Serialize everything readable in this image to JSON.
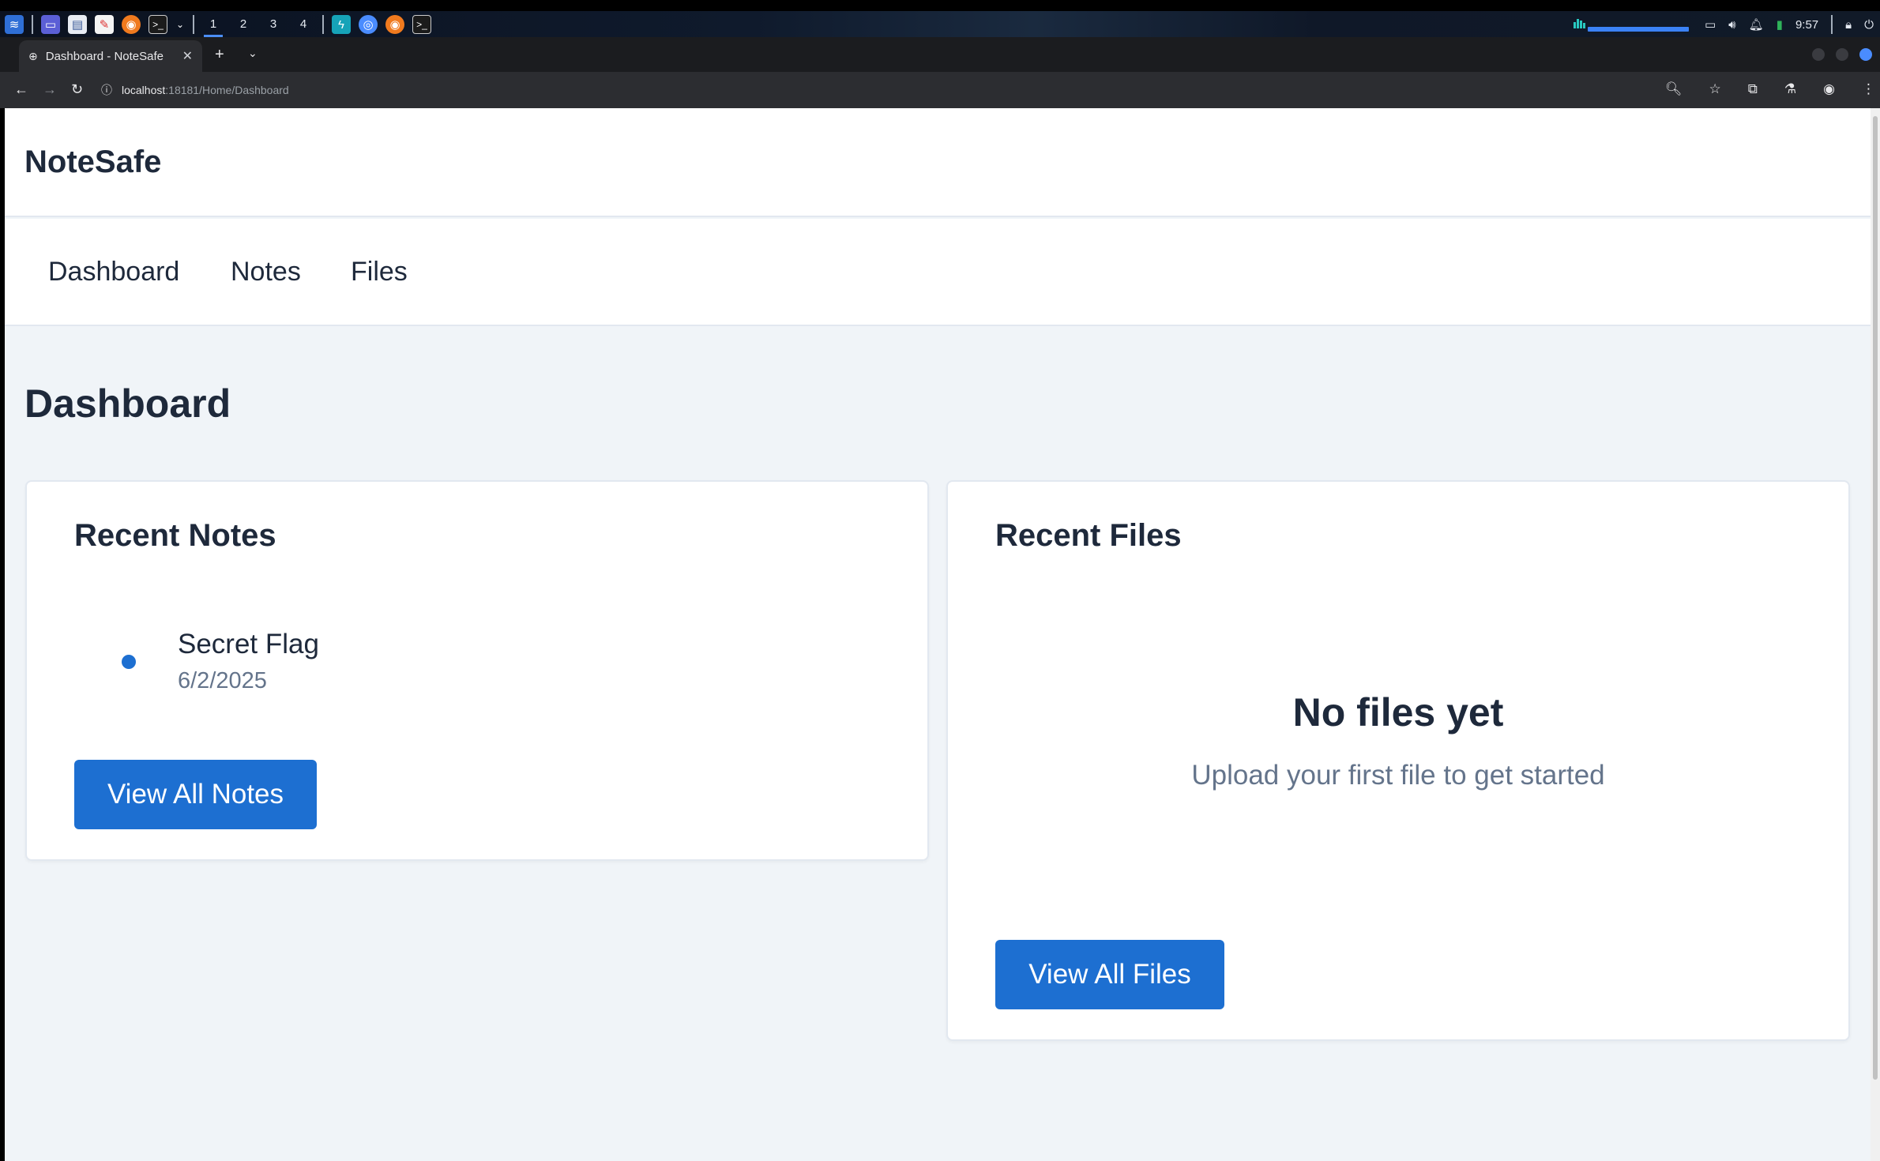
{
  "taskbar": {
    "workspaces": [
      "1",
      "2",
      "3",
      "4"
    ],
    "clock": "9:57"
  },
  "browser": {
    "tab_title": "Dashboard - NoteSafe",
    "tab_close": "✕",
    "new_tab": "+",
    "tab_list": "⌄",
    "url_host": "localhost",
    "url_path": ":18181/Home/Dashboard"
  },
  "app": {
    "brand": "NoteSafe",
    "nav": [
      "Dashboard",
      "Notes",
      "Files"
    ]
  },
  "page": {
    "title": "Dashboard"
  },
  "recent_notes": {
    "title": "Recent Notes",
    "items": [
      {
        "title": "Secret Flag",
        "date": "6/2/2025"
      }
    ],
    "button": "View All Notes"
  },
  "recent_files": {
    "title": "Recent Files",
    "empty_title": "No files yet",
    "empty_subtitle": "Upload your first file to get started",
    "button": "View All Files"
  },
  "colors": {
    "accent": "#1d6fd1",
    "page_bg": "#f0f4f8",
    "text_dark": "#1e293b",
    "text_muted": "#64748b"
  }
}
